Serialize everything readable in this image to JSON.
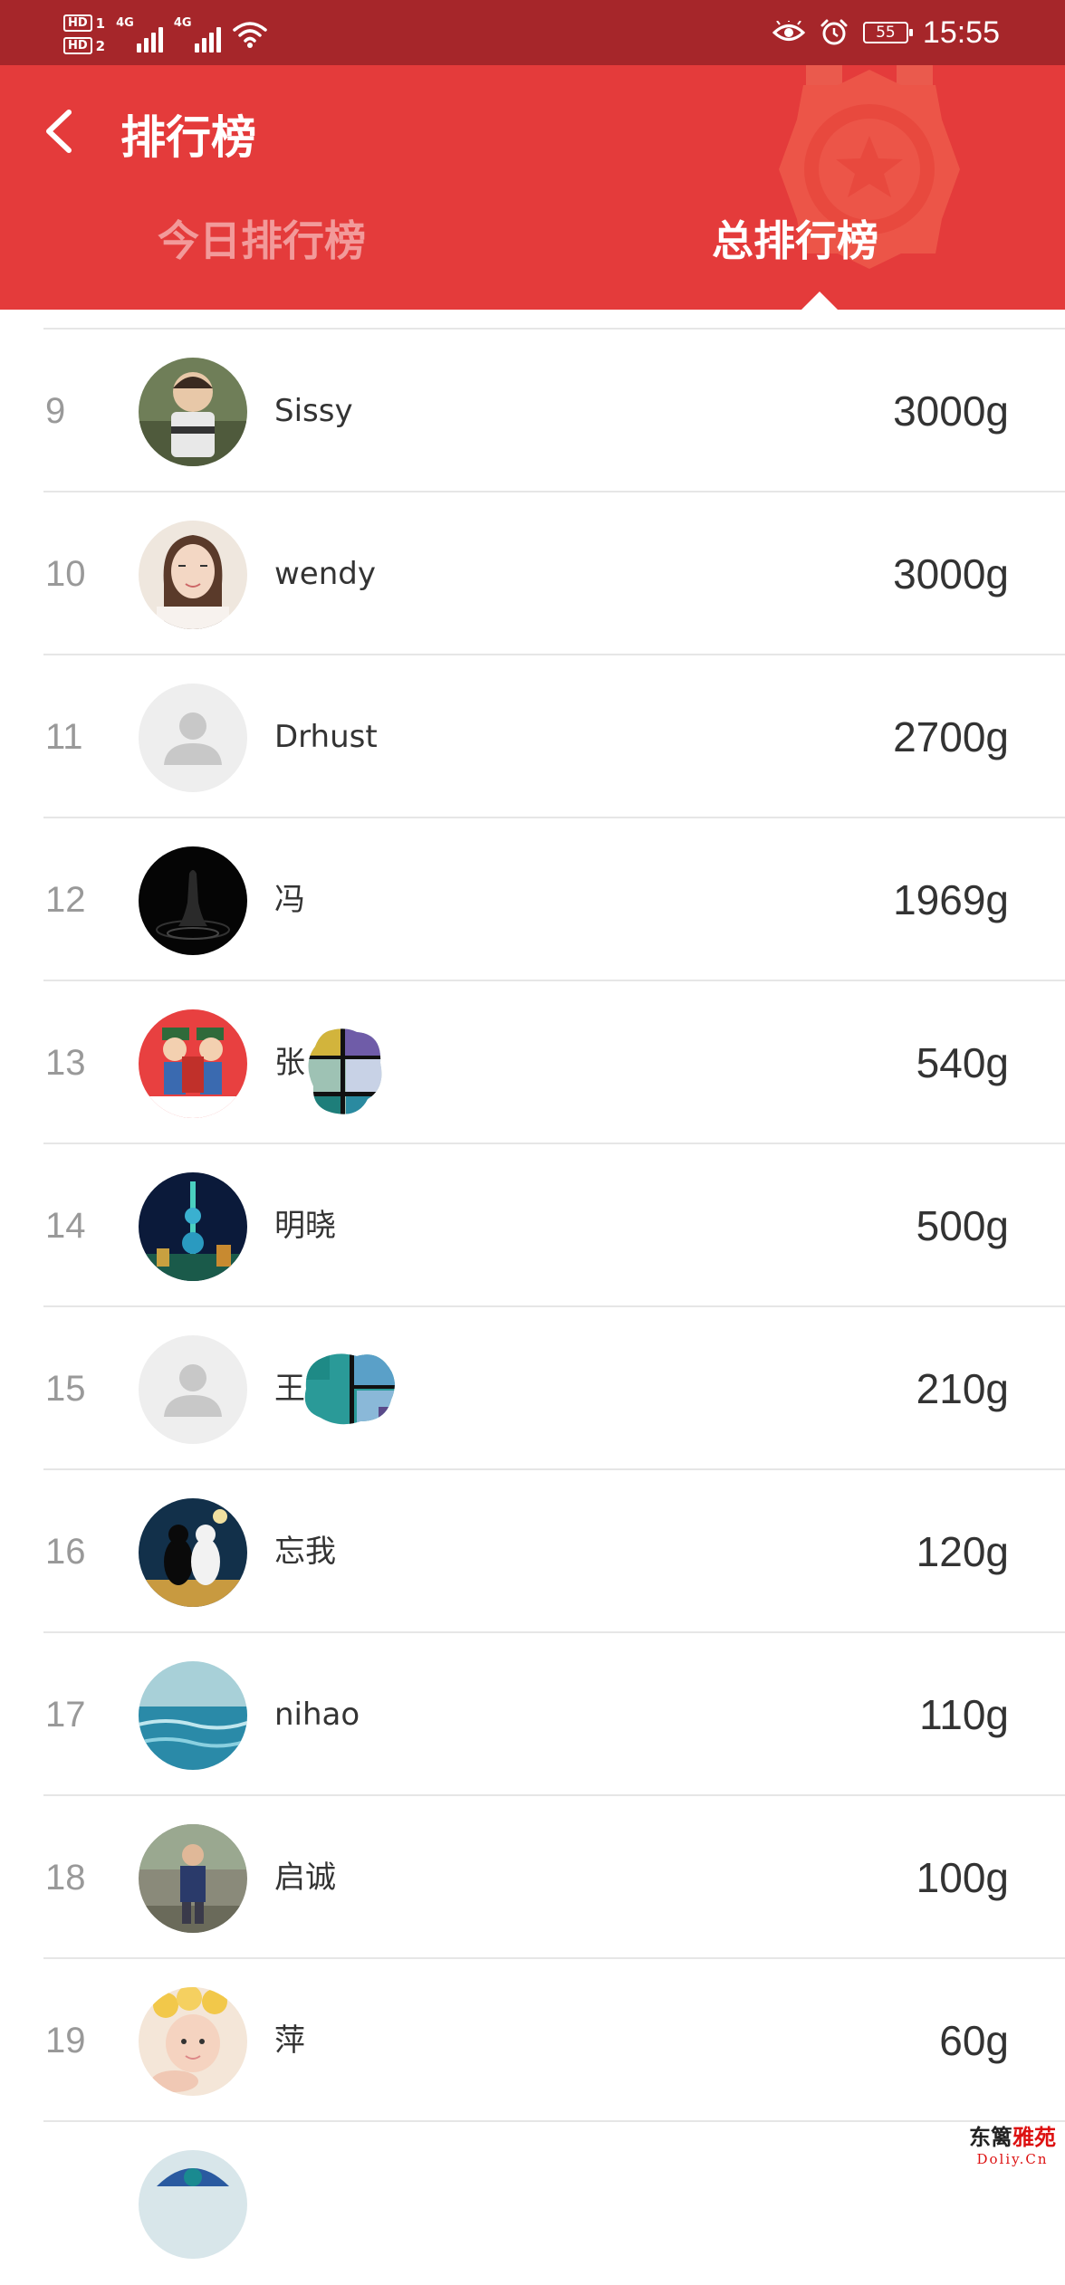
{
  "status_bar": {
    "sim1": "HD",
    "sim1_num": "1",
    "sim2": "HD",
    "sim2_num": "2",
    "net1": "4G",
    "net2": "4G",
    "battery": "55",
    "time": "15:55"
  },
  "header": {
    "title": "排行榜",
    "tabs": [
      {
        "label": "今日排行榜",
        "active": false
      },
      {
        "label": "总排行榜",
        "active": true
      }
    ]
  },
  "leaderboard": [
    {
      "rank": "9",
      "name": "Sissy",
      "score": "3000g",
      "avatar": "photo-baby"
    },
    {
      "rank": "10",
      "name": "wendy",
      "score": "3000g",
      "avatar": "photo-woman"
    },
    {
      "rank": "11",
      "name": "Drhust",
      "score": "2700g",
      "avatar": "default-person-icon"
    },
    {
      "rank": "12",
      "name": "冯",
      "score": "1969g",
      "avatar": "photo-dark"
    },
    {
      "rank": "13",
      "name": "张",
      "score": "540g",
      "avatar": "photo-cartoon"
    },
    {
      "rank": "14",
      "name": "明晓",
      "score": "500g",
      "avatar": "photo-tower"
    },
    {
      "rank": "15",
      "name": "王",
      "score": "210g",
      "avatar": "default-person-icon"
    },
    {
      "rank": "16",
      "name": "忘我",
      "score": "120g",
      "avatar": "photo-cats"
    },
    {
      "rank": "17",
      "name": "nihao",
      "score": "110g",
      "avatar": "photo-sea"
    },
    {
      "rank": "18",
      "name": "启诚",
      "score": "100g",
      "avatar": "photo-child"
    },
    {
      "rank": "19",
      "name": "萍",
      "score": "60g",
      "avatar": "photo-baby-flowers"
    }
  ],
  "watermark": {
    "line1_a": "东篱",
    "line1_b": "雅苑",
    "line2": "Doliy.Cn"
  },
  "colors": {
    "status_bar": "#a6262a",
    "header": "#e43b3b",
    "tab_inactive": "#f29a9a",
    "rank_text": "#999999",
    "divider": "#e6e6e6"
  }
}
